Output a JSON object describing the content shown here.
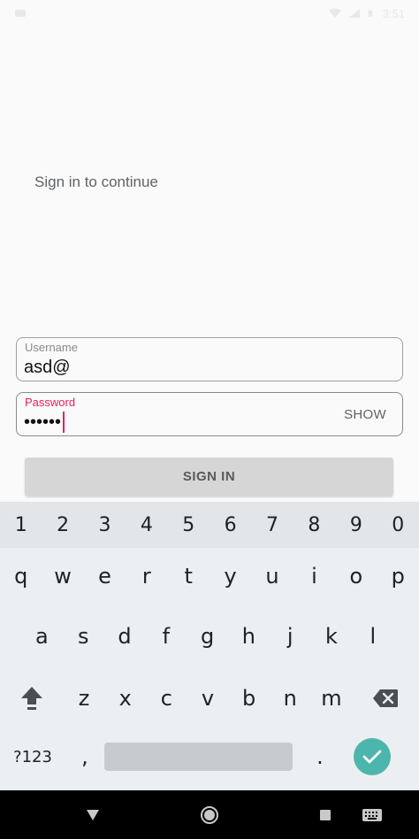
{
  "status_bar": {
    "time": "3:51"
  },
  "login": {
    "subtitle": "Sign in to continue",
    "username": {
      "label": "Username",
      "value": "asd@"
    },
    "password": {
      "label": "Password",
      "value": "••••••",
      "toggle_label": "SHOW"
    },
    "sign_in_label": "SIGN IN"
  },
  "keyboard": {
    "number_row": [
      "1",
      "2",
      "3",
      "4",
      "5",
      "6",
      "7",
      "8",
      "9",
      "0"
    ],
    "row1": [
      "q",
      "w",
      "e",
      "r",
      "t",
      "y",
      "u",
      "i",
      "o",
      "p"
    ],
    "row2": [
      "a",
      "s",
      "d",
      "f",
      "g",
      "h",
      "j",
      "k",
      "l"
    ],
    "row3": [
      "z",
      "x",
      "c",
      "v",
      "b",
      "n",
      "m"
    ],
    "symbols_label": "?123",
    "comma": ",",
    "period": ".",
    "accent_color": "#4db6ac"
  },
  "nav_bar": {
    "icons": [
      "back-icon",
      "home-icon",
      "recents-icon",
      "keyboard-switch-icon"
    ]
  }
}
